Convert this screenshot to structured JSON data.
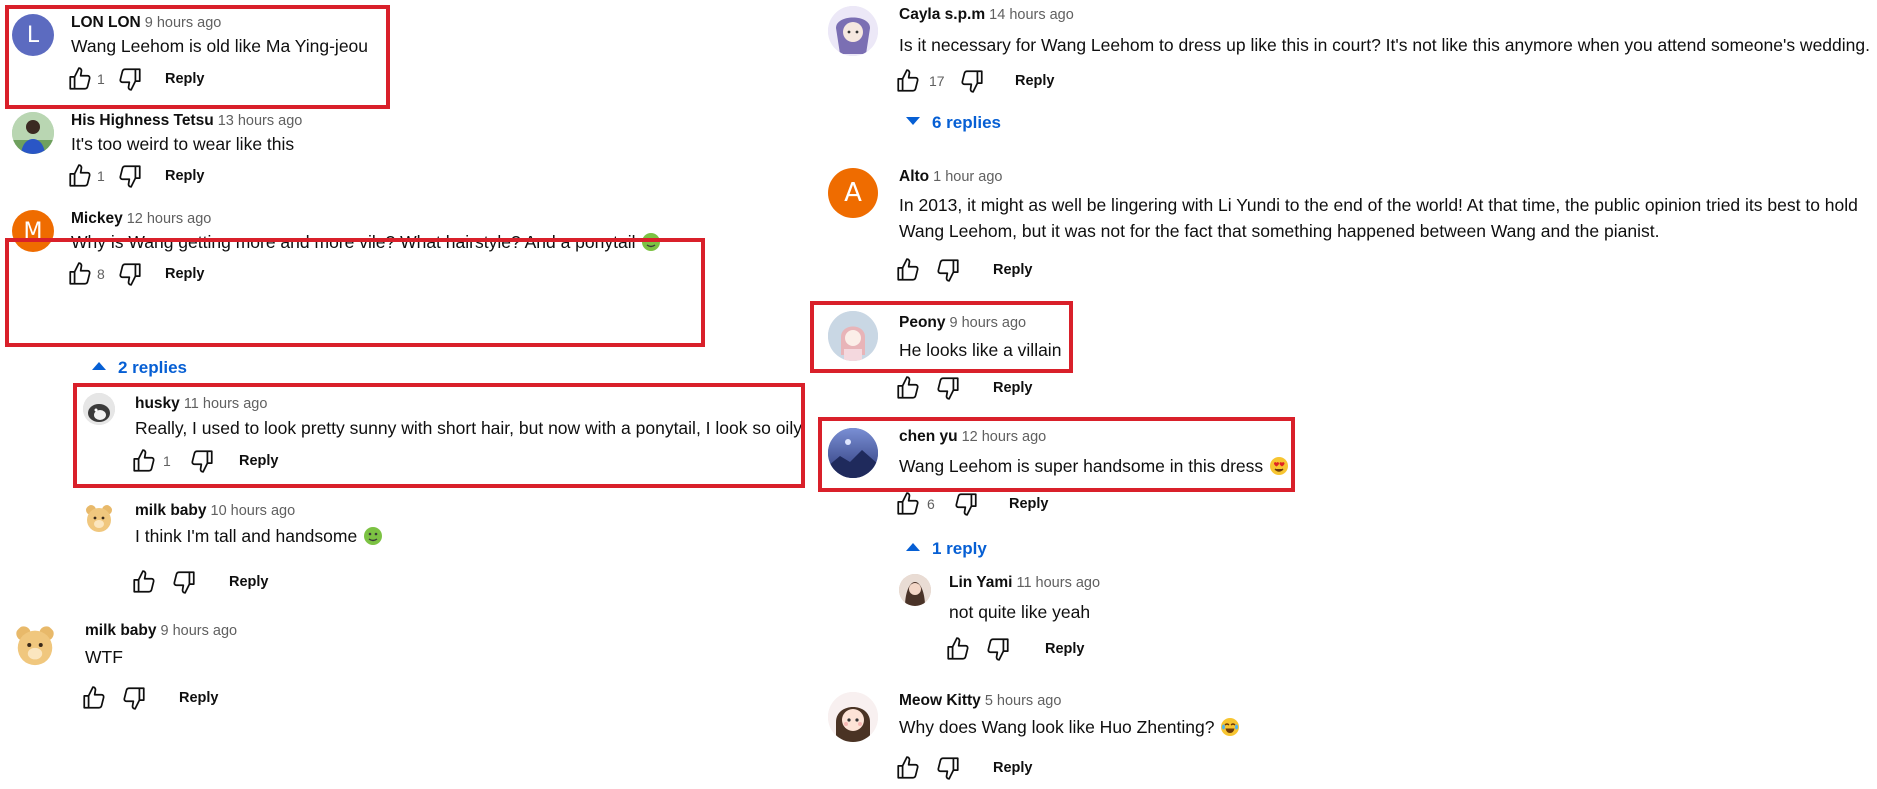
{
  "reply_label": "Reply",
  "highlight_color": "#d9202a",
  "link_color": "#065fd4",
  "left_column": {
    "c1": {
      "author": "LON LON",
      "time": "9 hours ago",
      "text": "Wang Leehom is old like Ma Ying-jeou",
      "likes": "1",
      "avatar_letter": "L",
      "avatar_color": "#5c6bc0"
    },
    "c2": {
      "author": "His Highness Tetsu",
      "time": "13 hours ago",
      "text": "It's too weird to wear like this",
      "likes": "1",
      "avatar_icon": "profile-photo-icon"
    },
    "c3": {
      "author": "Mickey",
      "time": "12 hours ago",
      "text": "Why is Wang getting more and more vile? What hairstyle? And a ponytail",
      "emoji": "nauseated-face-icon",
      "likes": "8",
      "avatar_letter": "M",
      "avatar_color": "#ef6c00"
    },
    "c3_replies_toggle": "2 replies",
    "r1": {
      "author": "husky",
      "time": "11 hours ago",
      "text": "Really, I used to look pretty sunny with short hair, but now with a ponytail, I look so oily",
      "likes": "1",
      "avatar_icon": "dog-photo-icon"
    },
    "r2": {
      "author": "milk baby",
      "time": "10 hours ago",
      "text": "I think I'm tall and handsome",
      "emoji": "nauseated-face-icon",
      "avatar_icon": "teddy-bear-icon"
    },
    "c4": {
      "author": "milk baby",
      "time": "9 hours ago",
      "text": "WTF",
      "avatar_icon": "teddy-bear-icon"
    }
  },
  "right_column": {
    "c5": {
      "author": "Cayla s.p.m",
      "time": "14 hours ago",
      "text": "Is it necessary for Wang Leehom to dress up like this in court? It's not like this anymore when you attend someone's wedding.",
      "likes": "17",
      "avatar_icon": "anime-girl-icon"
    },
    "c5_replies_toggle": "6 replies",
    "c6": {
      "author": "Alto",
      "time": "1 hour ago",
      "text_line1": "In 2013, it might as well be lingering with Li Yundi to the end of the world! At that time, the public opinion tried its best to hold",
      "text_line2": "Wang Leehom, but it was not for the fact that something happened between Wang and the pianist.",
      "avatar_letter": "A",
      "avatar_color": "#ef6c00"
    },
    "c7": {
      "author": "Peony",
      "time": "9 hours ago",
      "text": "He looks like a villain",
      "avatar_icon": "anime-portrait-icon"
    },
    "c8": {
      "author": "chen yu",
      "time": "12 hours ago",
      "text": "Wang Leehom is super handsome in this dress",
      "emoji": "heart-eyes-icon",
      "likes": "6",
      "avatar_icon": "blue-scenery-icon"
    },
    "c8_replies_toggle": "1 reply",
    "r3": {
      "author": "Lin Yami",
      "time": "11 hours ago",
      "text": "not quite like yeah",
      "avatar_icon": "photo-avatar-icon"
    },
    "c9": {
      "author": "Meow Kitty",
      "time": "5 hours ago",
      "text": "Why does Wang look like Huo Zhenting?",
      "emoji": "joy-face-icon",
      "avatar_icon": "cartoon-girl-icon"
    }
  }
}
